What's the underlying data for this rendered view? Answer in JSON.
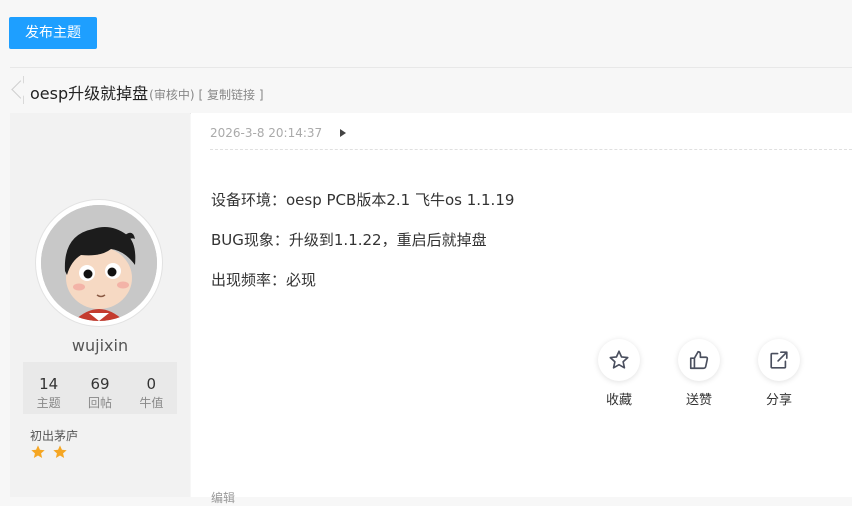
{
  "toolbar": {
    "post_label": "发布主题"
  },
  "thread": {
    "title": "oesp升级就掉盘",
    "status": "(审核中)",
    "copy_link": "[ 复制链接 ]"
  },
  "author": {
    "username": "wujixin",
    "stats": [
      {
        "value": "14",
        "label": "主题"
      },
      {
        "value": "69",
        "label": "回帖"
      },
      {
        "value": "0",
        "label": "牛值"
      }
    ],
    "rank": "初出茅庐",
    "star_color": "#f5a623"
  },
  "post": {
    "timestamp": "2026-3-8 20:14:37",
    "lines": [
      "设备环境：oesp PCB版本2.1 飞牛os 1.1.19",
      "BUG现象：升级到1.1.22，重启后就掉盘",
      "出现频率：必现"
    ],
    "edit_label": "编辑"
  },
  "actions": {
    "favorite": {
      "label": "收藏",
      "icon": "star-outline-icon"
    },
    "like": {
      "label": "送赞",
      "icon": "thumbs-up-icon"
    },
    "share": {
      "label": "分享",
      "icon": "external-link-icon"
    }
  },
  "colors": {
    "accent": "#1e9fff"
  }
}
